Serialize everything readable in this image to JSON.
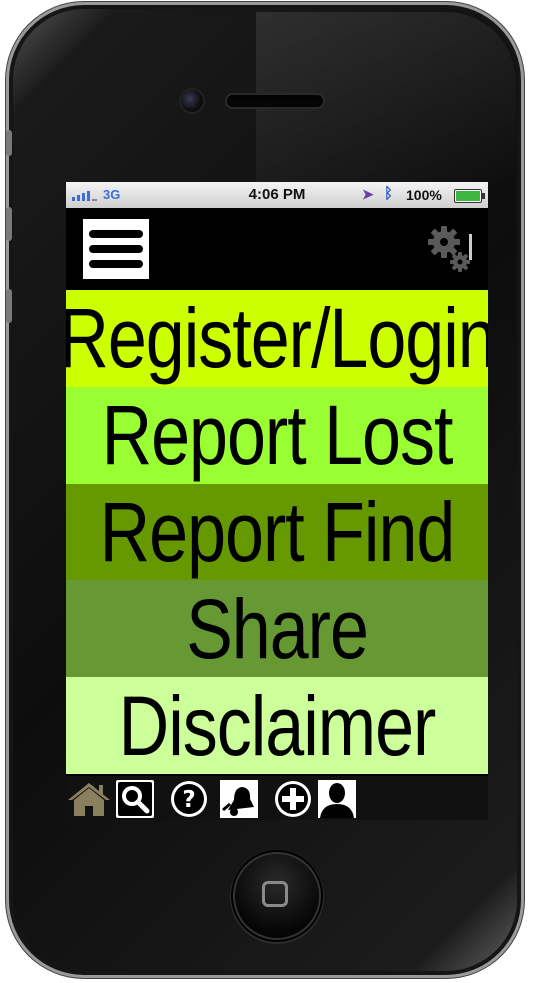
{
  "status_bar": {
    "network": "3G",
    "time": "4:06 PM",
    "battery_pct": "100%",
    "battery_level": 1.0,
    "signal_bars": 4,
    "location_icon": "location-arrow-icon",
    "bluetooth_icon": "bluetooth-icon"
  },
  "header": {
    "menu_icon": "hamburger-menu-icon",
    "settings_icon": "gear-icon"
  },
  "nav": {
    "items": [
      {
        "label": "Register/Login",
        "color": "#CCFF00"
      },
      {
        "label": "Report Lost",
        "color": "#99FF33"
      },
      {
        "label": "Report Find",
        "color": "#669900"
      },
      {
        "label": "Share",
        "color": "#669933"
      },
      {
        "label": "Disclaimer",
        "color": "#CCFF99"
      }
    ]
  },
  "toolbar": {
    "icons": [
      "home-icon",
      "search-icon",
      "help-icon",
      "notification-bell-icon",
      "add-icon",
      "profile-icon"
    ]
  },
  "colors": {
    "phone_body": "#0d0d0d",
    "screen_background": "#000000",
    "status_bar": "#e0e0e0"
  }
}
